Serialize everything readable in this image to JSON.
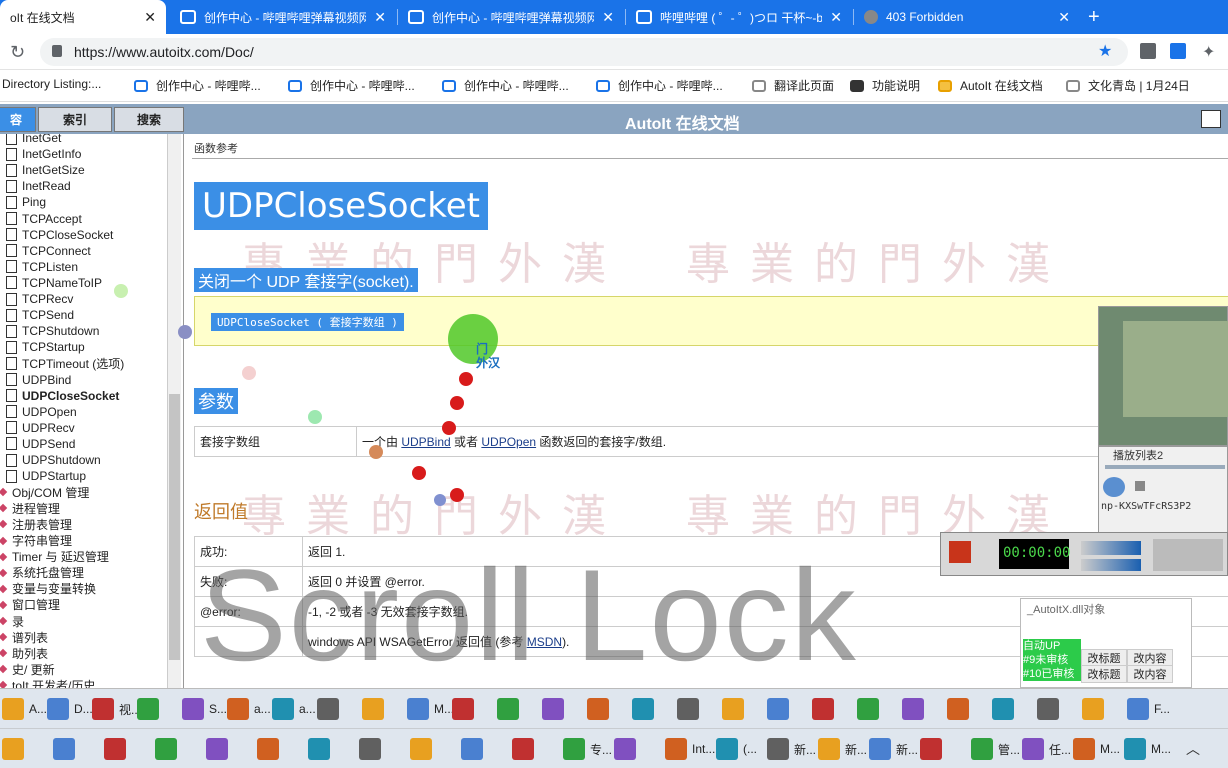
{
  "tabs": [
    {
      "label": "oIt 在线文档",
      "active": true
    },
    {
      "label": "创作中心 - 哔哩哔哩弹幕视频网",
      "active": false
    },
    {
      "label": "创作中心 - 哔哩哔哩弹幕视频网",
      "active": false
    },
    {
      "label": "哔哩哔哩 ( ゜- ゜)つロ 干杯~-b",
      "active": false
    },
    {
      "label": "403 Forbidden",
      "active": false
    }
  ],
  "address": {
    "url": "https://www.autoitx.com/Doc/"
  },
  "bookmarks": [
    "Directory Listing:...",
    "创作中心 - 哔哩哔...",
    "创作中心 - 哔哩哔...",
    "创作中心 - 哔哩哔...",
    "创作中心 - 哔哩哔...",
    "翻译此页面",
    "功能说明",
    "AutoIt 在线文档",
    "文化青岛 | 1月24日"
  ],
  "help": {
    "title": "AutoIt 在线文档",
    "nav_tabs": [
      "容",
      "索引",
      "搜索"
    ]
  },
  "tree": {
    "items": [
      {
        "label": "InetGet",
        "type": "doc"
      },
      {
        "label": "InetGetInfo",
        "type": "doc"
      },
      {
        "label": "InetGetSize",
        "type": "doc"
      },
      {
        "label": "InetRead",
        "type": "doc"
      },
      {
        "label": "Ping",
        "type": "doc"
      },
      {
        "label": "TCPAccept",
        "type": "doc"
      },
      {
        "label": "TCPCloseSocket",
        "type": "doc"
      },
      {
        "label": "TCPConnect",
        "type": "doc"
      },
      {
        "label": "TCPListen",
        "type": "doc"
      },
      {
        "label": "TCPNameToIP",
        "type": "doc"
      },
      {
        "label": "TCPRecv",
        "type": "doc"
      },
      {
        "label": "TCPSend",
        "type": "doc"
      },
      {
        "label": "TCPShutdown",
        "type": "doc"
      },
      {
        "label": "TCPStartup",
        "type": "doc"
      },
      {
        "label": "TCPTimeout (选项)",
        "type": "doc"
      },
      {
        "label": "UDPBind",
        "type": "doc"
      },
      {
        "label": "UDPCloseSocket",
        "type": "doc",
        "bold": true
      },
      {
        "label": "UDPOpen",
        "type": "doc"
      },
      {
        "label": "UDPRecv",
        "type": "doc"
      },
      {
        "label": "UDPSend",
        "type": "doc"
      },
      {
        "label": "UDPShutdown",
        "type": "doc"
      },
      {
        "label": "UDPStartup",
        "type": "doc"
      },
      {
        "label": "Obj/COM 管理",
        "type": "folder"
      },
      {
        "label": "进程管理",
        "type": "folder"
      },
      {
        "label": "注册表管理",
        "type": "folder"
      },
      {
        "label": "字符串管理",
        "type": "folder"
      },
      {
        "label": "Timer 与 延迟管理",
        "type": "folder"
      },
      {
        "label": "系统托盘管理",
        "type": "folder"
      },
      {
        "label": "变量与变量转换",
        "type": "folder"
      },
      {
        "label": "窗口管理",
        "type": "folder"
      },
      {
        "label": "录",
        "type": "folder"
      },
      {
        "label": "谱列表",
        "type": "folder"
      },
      {
        "label": "助列表",
        "type": "folder"
      },
      {
        "label": "史/ 更新",
        "type": "folder"
      },
      {
        "label": "toIt 开发者/历史",
        "type": "folder"
      }
    ]
  },
  "content": {
    "breadcrumb": "函数参考",
    "heading": "UDPCloseSocket",
    "description": "关闭一个 UDP 套接字(socket).",
    "syntax": "UDPCloseSocket ( 套接字数组 )",
    "params_heading": "参数",
    "params": [
      {
        "name": "套接字数组",
        "desc_pre": "一个由 ",
        "link1": "UDPBind",
        "desc_mid": " 或者 ",
        "link2": "UDPOpen",
        "desc_post": " 函数返回的套接字/数组."
      }
    ],
    "return_heading": "返回值",
    "returns": [
      {
        "label": "成功:",
        "value": "返回 1."
      },
      {
        "label": "失败:",
        "value": "返回 0 并设置 @error."
      },
      {
        "label": "@error:",
        "value": "-1, -2 或者 -3 无效套接字数组."
      },
      {
        "label": "",
        "value_pre": "windows API WSAGetError 返回值 (参考 ",
        "link": "MSDN",
        "value_post": ")."
      }
    ],
    "watermark": "專業的門外漢",
    "overlay_text": "Scroll Lock",
    "cursor_label": "门\n外汉"
  },
  "overlays": {
    "playlist_label": "播放列表2",
    "player_caption": "np-KXSwTFcRS3P2",
    "recorder_time": "00:00:00",
    "notepad_title": "_AutoItX.dll对象",
    "notepad_rows": [
      {
        "left": "自动UP",
        "mid": "",
        "right": ""
      },
      {
        "left": "#9未审核",
        "mid": "改标题",
        "right": "改内容"
      },
      {
        "left": "#10已审核",
        "mid": "改标题",
        "right": "改内容"
      }
    ]
  },
  "taskbar_top": [
    "A...",
    "D...",
    "视...",
    "",
    "S...",
    "a...",
    "a...",
    "",
    "",
    "M...",
    "",
    "",
    "",
    "",
    "",
    "",
    "",
    "",
    "",
    "",
    "",
    "",
    "",
    "",
    "",
    "F..."
  ],
  "taskbar_bottom": [
    "",
    "",
    "",
    "",
    "",
    "",
    "",
    "",
    "",
    "",
    "",
    "专...",
    "",
    "Int...",
    "(...",
    "新...",
    "新...",
    "新...",
    "",
    "管...",
    "任...",
    "M...",
    "M..."
  ],
  "colors": {
    "tab_strip": "#1a73e8",
    "help_header": "#8aa4c0",
    "selection": "#3b8fe6",
    "syntax_bg": "#ffffcc"
  }
}
